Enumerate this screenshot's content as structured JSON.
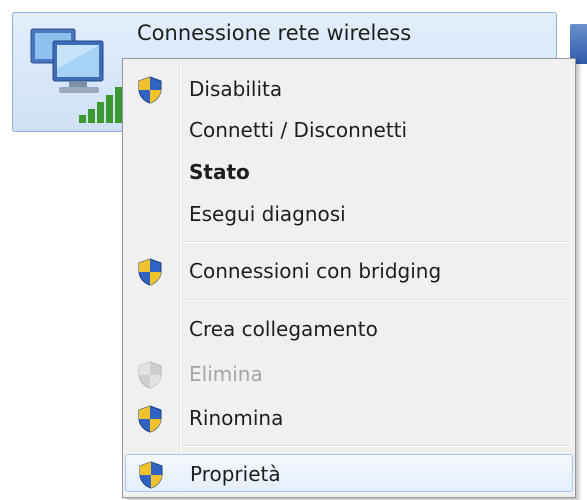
{
  "connection": {
    "name": "Connessione rete wireless",
    "icon": "wireless-network-adapter-icon"
  },
  "menu": {
    "items": [
      {
        "label": "Disabilita",
        "icon": "uac-shield-icon",
        "bold": false,
        "disabled": false
      },
      {
        "label": "Connetti / Disconnetti",
        "icon": "",
        "bold": false,
        "disabled": false
      },
      {
        "label": "Stato",
        "icon": "",
        "bold": true,
        "disabled": false
      },
      {
        "label": "Esegui diagnosi",
        "icon": "",
        "bold": false,
        "disabled": false
      },
      {
        "label": "Connessioni con bridging",
        "icon": "uac-shield-icon",
        "bold": false,
        "disabled": false
      },
      {
        "label": "Crea collegamento",
        "icon": "",
        "bold": false,
        "disabled": false
      },
      {
        "label": "Elimina",
        "icon": "uac-shield-icon",
        "bold": false,
        "disabled": true
      },
      {
        "label": "Rinomina",
        "icon": "uac-shield-icon",
        "bold": false,
        "disabled": false
      },
      {
        "label": "Proprietà",
        "icon": "uac-shield-icon",
        "bold": false,
        "disabled": false,
        "highlighted": true
      }
    ]
  },
  "colors": {
    "menu_bg": "#f0f0f0",
    "selection_bg": "#cfe0f6",
    "disabled_text": "#a5a5a5",
    "shield_blue": "#2f64c4",
    "shield_yellow": "#f2c22a"
  }
}
